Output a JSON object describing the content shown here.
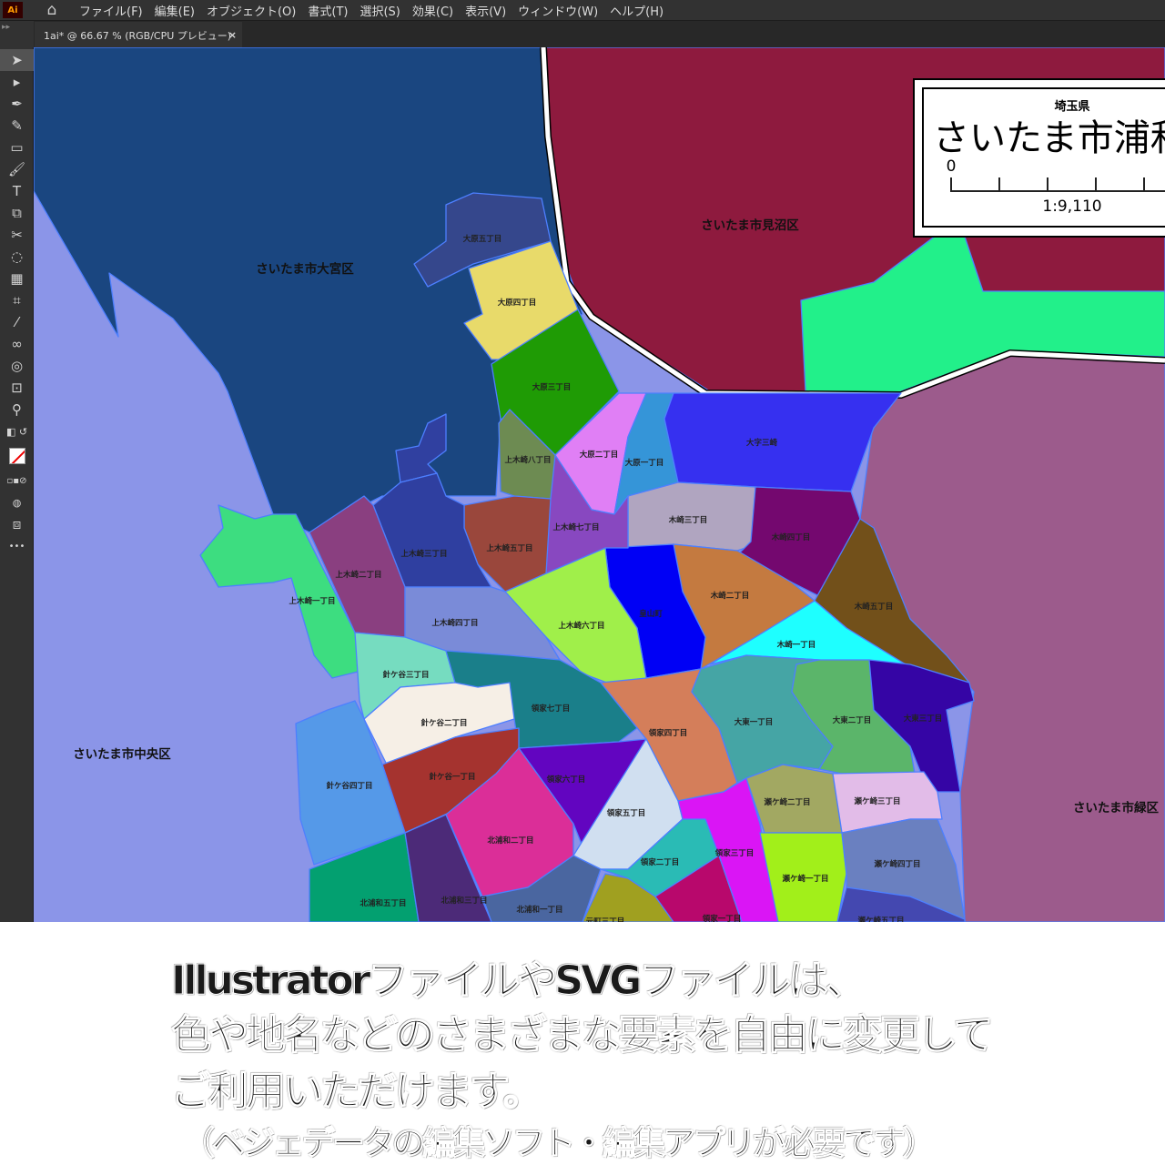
{
  "app": {
    "logo": "Ai",
    "menu": [
      "ファイル(F)",
      "編集(E)",
      "オブジェクト(O)",
      "書式(T)",
      "選択(S)",
      "効果(C)",
      "表示(V)",
      "ウィンドウ(W)",
      "ヘルプ(H)"
    ]
  },
  "document_tab": {
    "title": "1ai* @ 66.67 % (RGB/CPU プレビュー)",
    "close": "×"
  },
  "toolbar": {
    "tools": [
      "selection-tool",
      "direct-selection-tool",
      "pen-tool",
      "curvature-tool",
      "rectangle-tool",
      "paintbrush-tool",
      "type-tool",
      "scale-tool",
      "scissors-tool",
      "lasso-tool",
      "gradient-tool",
      "mesh-tool",
      "eyedropper-tool",
      "blend-tool",
      "shape-builder-tool",
      "artboard-tool",
      "zoom-tool",
      "swap-colors",
      "fill-stroke",
      "draw-modes",
      "screen-mode",
      "more-tools"
    ],
    "more": "•••"
  },
  "map": {
    "title_box": {
      "prefecture": "埼玉県",
      "title": "さいたま市浦和",
      "scale_zero": "0",
      "scale": "1:9,110"
    },
    "wards": {
      "omiya": "さいたま市大宮区",
      "minuma": "さいたま市見沼区",
      "chuo": "さいたま市中央区",
      "midori": "さいたま市緑区"
    },
    "districts": [
      "大原五丁目",
      "大原四丁目",
      "大原三丁目",
      "大原二丁目",
      "大原一丁目",
      "大字三崎",
      "木崎三丁目",
      "木崎四丁目",
      "木崎五丁目",
      "木崎一丁目",
      "木崎二丁目",
      "皇山町",
      "上木崎六丁目",
      "上木崎七丁目",
      "上木崎八丁目",
      "上木崎五丁目",
      "上木崎三丁目",
      "上木崎二丁目",
      "上木崎一丁目",
      "上木崎四丁目",
      "針ケ谷三丁目",
      "領家七丁目",
      "針ケ谷二丁目",
      "針ケ谷一丁目",
      "針ケ谷四丁目",
      "北浦和五丁目",
      "北浦和三丁目",
      "北浦和二丁目",
      "領家六丁目",
      "領家四丁目",
      "領家五丁目",
      "北浦和一丁目",
      "元町三丁目",
      "領家二丁目",
      "領家一丁目",
      "領家三丁目",
      "大東一丁目",
      "大東二丁目",
      "大東三丁目",
      "瀬ケ崎二丁目",
      "瀬ケ崎三丁目",
      "瀬ケ崎一丁目",
      "瀬ケ崎四丁目",
      "瀬ケ崎五丁目"
    ]
  },
  "caption": {
    "line1": "IllustratorファイルやSVGファイルは、",
    "line2": "色や地名などのさまざまな要素を自由に変更して",
    "line3": "ご利用いただけます。",
    "line4": "（ベジェデータの編集ソフト・編集アプリが必要です）"
  }
}
